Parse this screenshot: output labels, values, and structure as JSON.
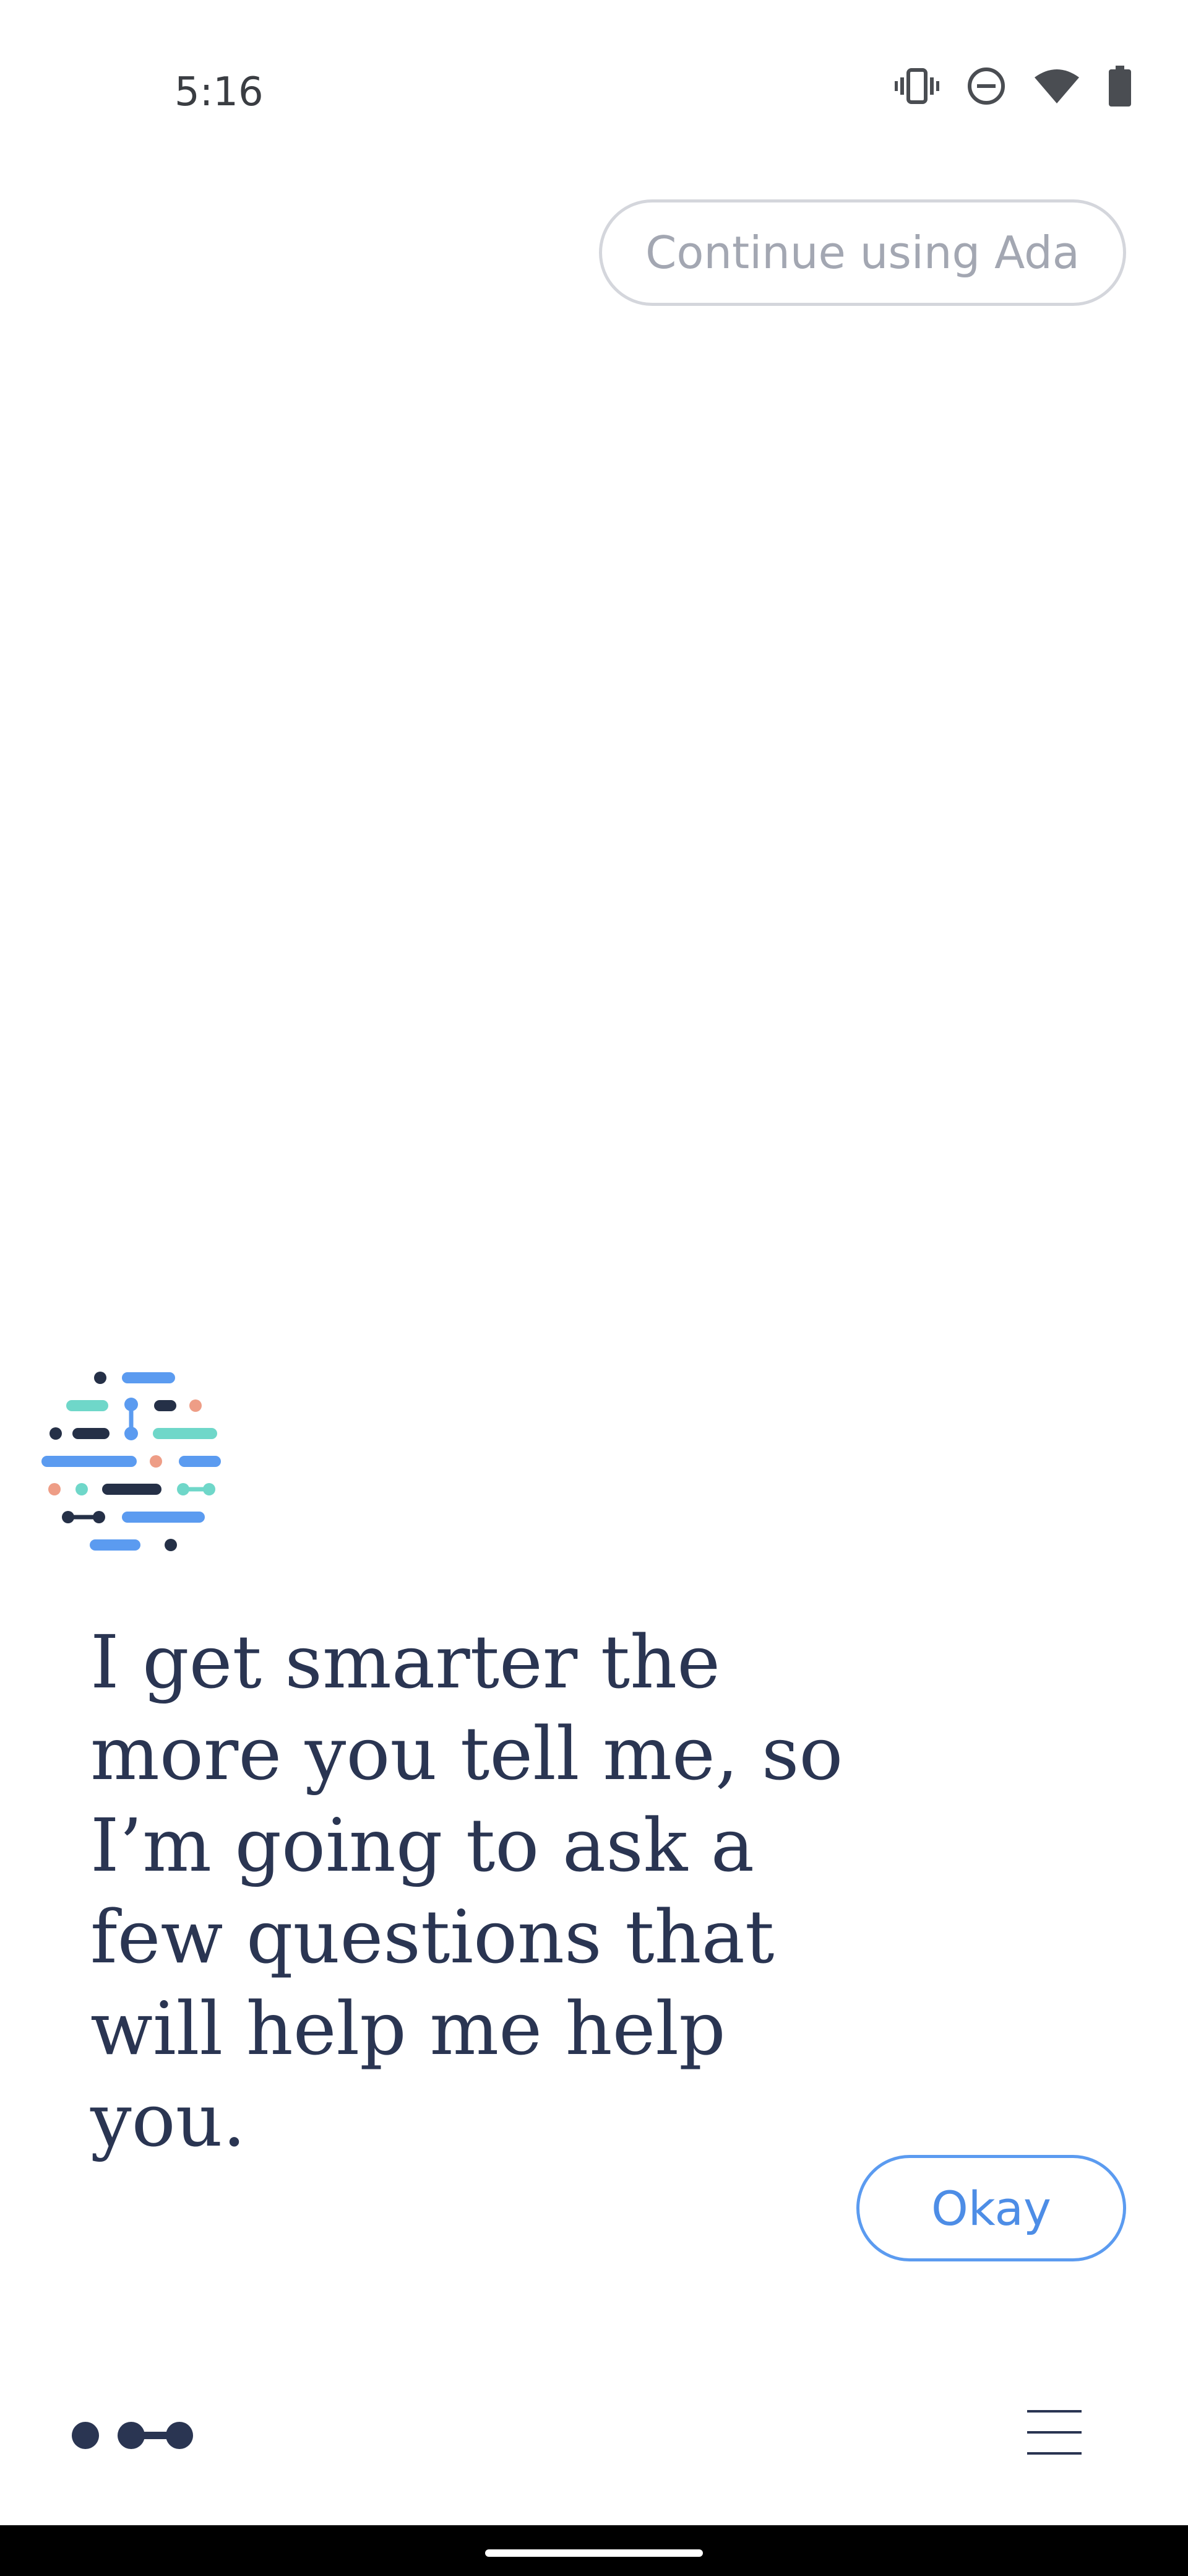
{
  "status_bar": {
    "time": "5:16",
    "icons": [
      "vibrate-icon",
      "do-not-disturb-icon",
      "wifi-icon",
      "battery-icon"
    ]
  },
  "header": {
    "continue_label": "Continue using Ada"
  },
  "conversation": {
    "message": "I get smarter the more you tell me, so I’m going to ask a few questions that will help me help you."
  },
  "actions": {
    "okay_label": "Okay"
  },
  "footer": {
    "left_icon": "ada-connect-icon",
    "menu_icon": "hamburger-menu-icon"
  },
  "colors": {
    "text_dark": "#2a3552",
    "accent_blue": "#5b9bf0",
    "teal": "#6fd7c9",
    "coral": "#ee9d86",
    "navy": "#253047",
    "muted_gray": "#a3a7b2"
  }
}
